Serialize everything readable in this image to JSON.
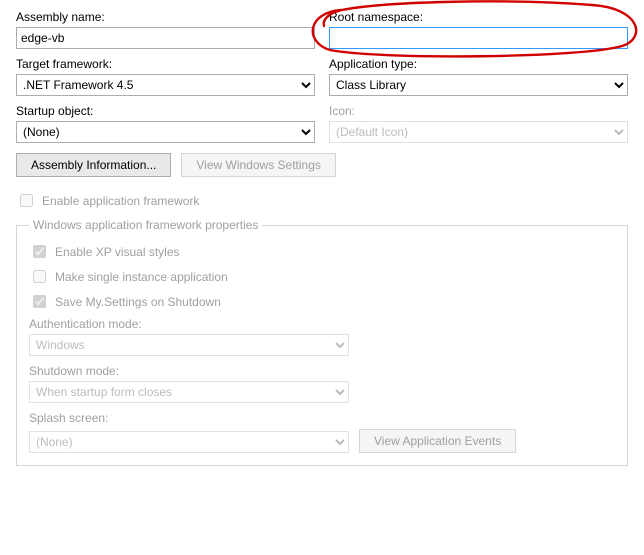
{
  "row1": {
    "assembly_name_label": "Assembly name:",
    "assembly_name_value": "edge-vb",
    "root_namespace_label": "Root namespace:",
    "root_namespace_value": ""
  },
  "row2": {
    "target_framework_label": "Target framework:",
    "target_framework_value": ".NET Framework 4.5",
    "application_type_label": "Application type:",
    "application_type_value": "Class Library"
  },
  "row3": {
    "startup_object_label": "Startup object:",
    "startup_object_value": "(None)",
    "icon_label": "Icon:",
    "icon_value": "(Default Icon)"
  },
  "buttons": {
    "assembly_info": "Assembly Information...",
    "view_windows_settings": "View Windows Settings"
  },
  "enable_app_framework_label": "Enable application framework",
  "group": {
    "legend": "Windows application framework properties",
    "enable_xp_label": "Enable XP visual styles",
    "single_instance_label": "Make single instance application",
    "save_settings_label": "Save My.Settings on Shutdown",
    "auth_mode_label": "Authentication mode:",
    "auth_mode_value": "Windows",
    "shutdown_mode_label": "Shutdown mode:",
    "shutdown_mode_value": "When startup form closes",
    "splash_label": "Splash screen:",
    "splash_value": "(None)",
    "view_app_events": "View Application Events"
  }
}
